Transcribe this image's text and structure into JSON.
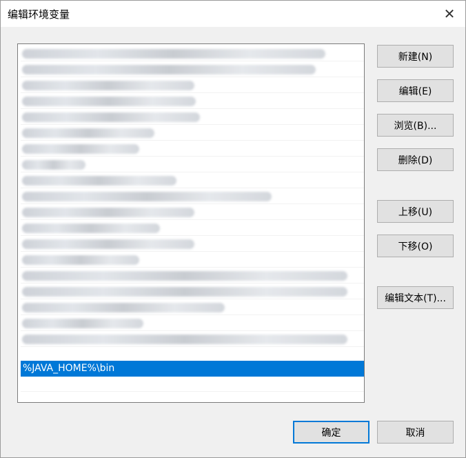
{
  "window": {
    "title": "编辑环境变量",
    "close_glyph": "✕"
  },
  "list": {
    "selected_entry": "%JAVA_HOME%\\bin"
  },
  "buttons": {
    "new": "新建(N)",
    "edit": "编辑(E)",
    "browse": "浏览(B)...",
    "delete": "删除(D)",
    "move_up": "上移(U)",
    "move_down": "下移(O)",
    "edit_text": "编辑文本(T)...",
    "ok": "确定",
    "cancel": "取消"
  },
  "colors": {
    "selection": "#0078d7",
    "dialog_bg": "#f0f0f0",
    "button_bg": "#e1e1e1"
  }
}
